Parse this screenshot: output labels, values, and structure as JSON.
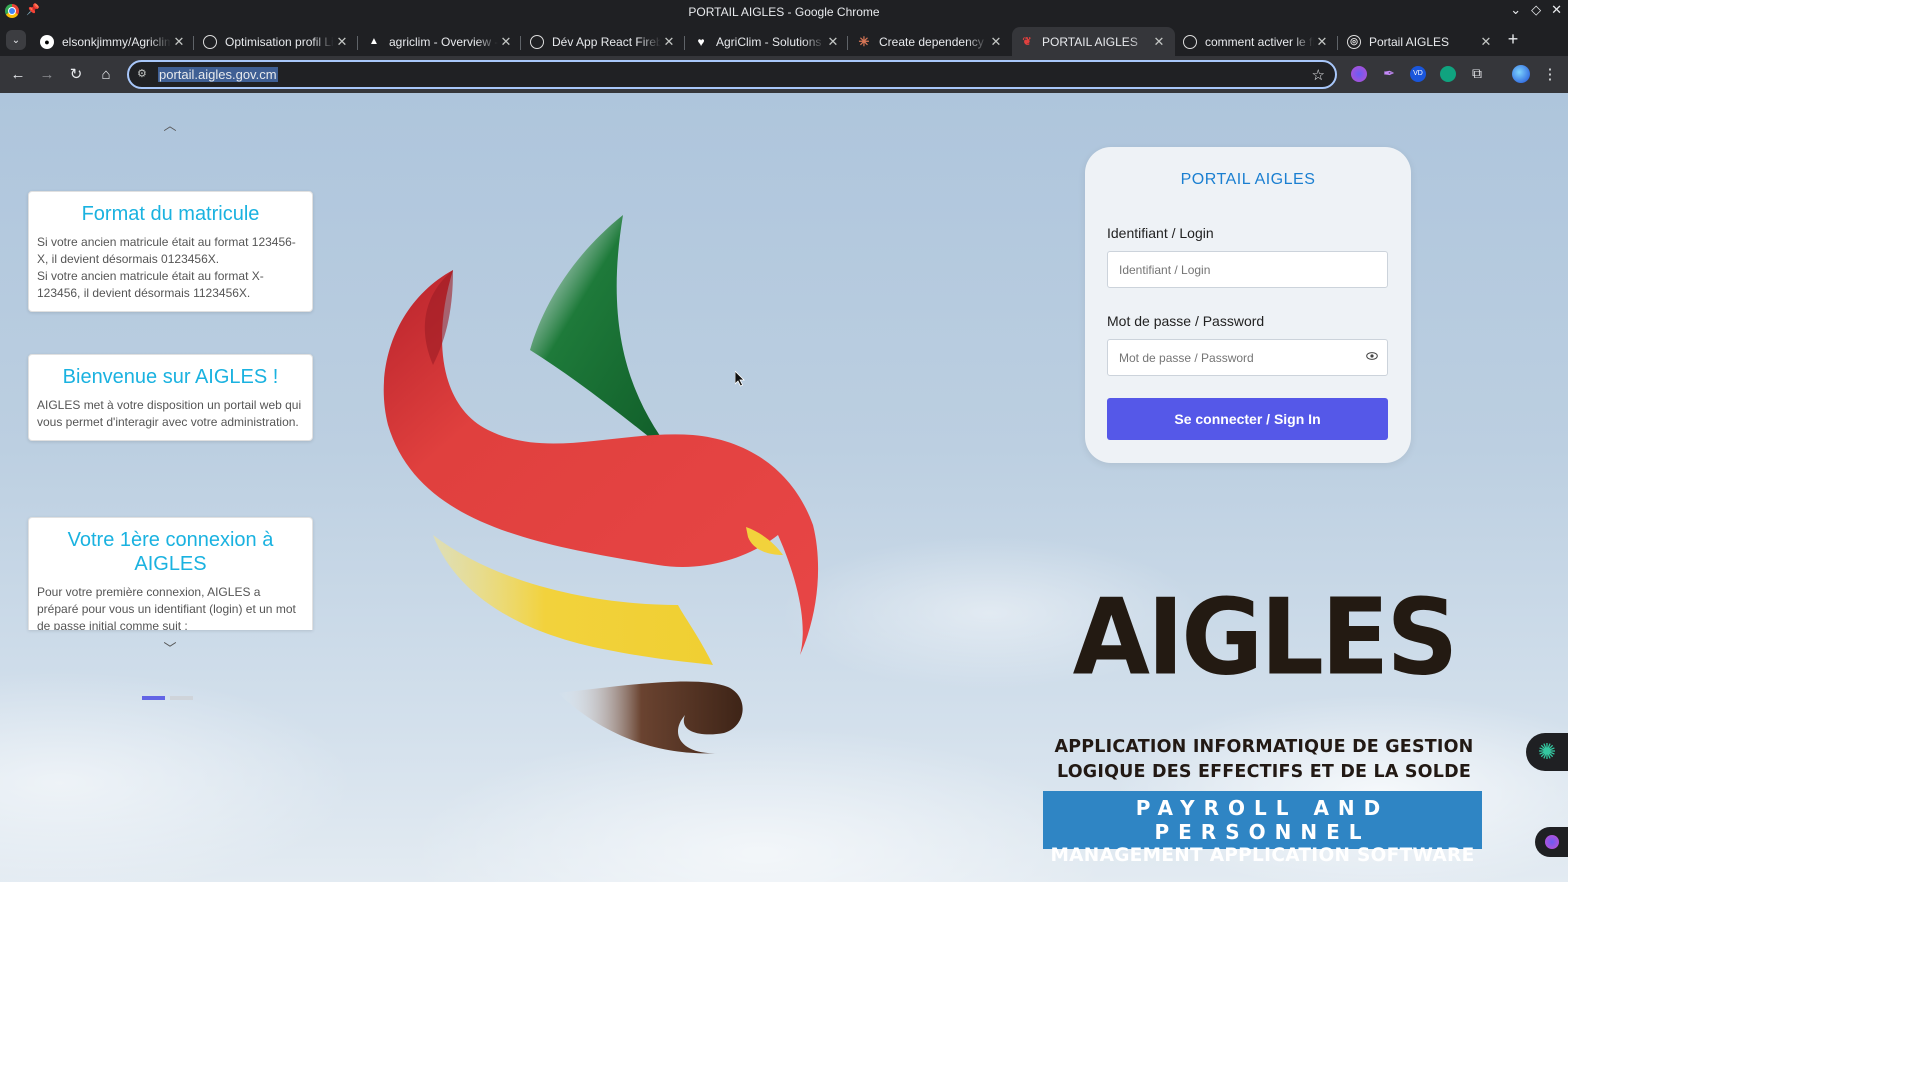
{
  "window": {
    "title": "PORTAIL AIGLES - Google Chrome"
  },
  "tabs": [
    {
      "label": "elsonkjimmy/Agriclim",
      "favicon": "github-icon",
      "active": false
    },
    {
      "label": "Optimisation profil LinkedIn",
      "favicon": "openai-icon",
      "active": false
    },
    {
      "label": "agriclim - Overview - Vercel",
      "favicon": "vercel-icon",
      "active": false
    },
    {
      "label": "Dév App React Firebase",
      "favicon": "openai-icon",
      "active": false
    },
    {
      "label": "AgriClim - Solutions Innovantes",
      "favicon": "heart-icon",
      "active": false
    },
    {
      "label": "Create dependency map",
      "favicon": "claude-icon",
      "active": false
    },
    {
      "label": "PORTAIL AIGLES",
      "favicon": "aigles-icon",
      "active": true
    },
    {
      "label": "comment activer le fichier",
      "favicon": "openai-icon",
      "active": false
    },
    {
      "label": "Portail AIGLES",
      "favicon": "globe-icon",
      "active": false
    }
  ],
  "toolbar": {
    "url": "portail.aigles.gov.cm"
  },
  "carousel": {
    "cards": [
      {
        "title": "Format du matricule",
        "lines": [
          "Si votre ancien matricule était au format 123456-X, il devient désormais 0123456X.",
          "Si votre ancien matricule était au format X-123456, il devient désormais 1123456X."
        ]
      },
      {
        "title": "Bienvenue sur AIGLES !",
        "lines": [
          "AIGLES met à votre disposition un portail web qui vous permet d'interagir avec votre administration."
        ]
      },
      {
        "title": "Votre 1ère connexion à AIGLES",
        "lines": [
          "Pour votre première connexion, AIGLES a préparé pour vous un identifiant (login) et un mot de passe initial comme suit :"
        ]
      }
    ],
    "page_count": 2,
    "current_page": 1
  },
  "login": {
    "title": "PORTAIL AIGLES",
    "login_label": "Identifiant / Login",
    "login_placeholder": "Identifiant / Login",
    "password_label": "Mot de passe / Password",
    "password_placeholder": "Mot de passe / Password",
    "submit_label": "Se connecter / Sign In"
  },
  "brand": {
    "name": "AIGLES",
    "fr_line1": "APPLICATION INFORMATIQUE DE GESTION",
    "fr_line2": "LOGIQUE DES EFFECTIFS ET DE LA SOLDE",
    "en_line1": "PAYROLL AND PERSONNEL",
    "en_line2": "MANAGEMENT APPLICATION SOFTWARE"
  },
  "colors": {
    "accent": "#5558e8",
    "card_title": "#1ab2e0",
    "login_title": "#1a7fd1",
    "brand_blue": "#2f85c4",
    "emblem_green": "#1e7a3a",
    "emblem_red": "#e0403e",
    "emblem_yellow": "#f2d23c",
    "emblem_brown": "#4a2c1c"
  }
}
